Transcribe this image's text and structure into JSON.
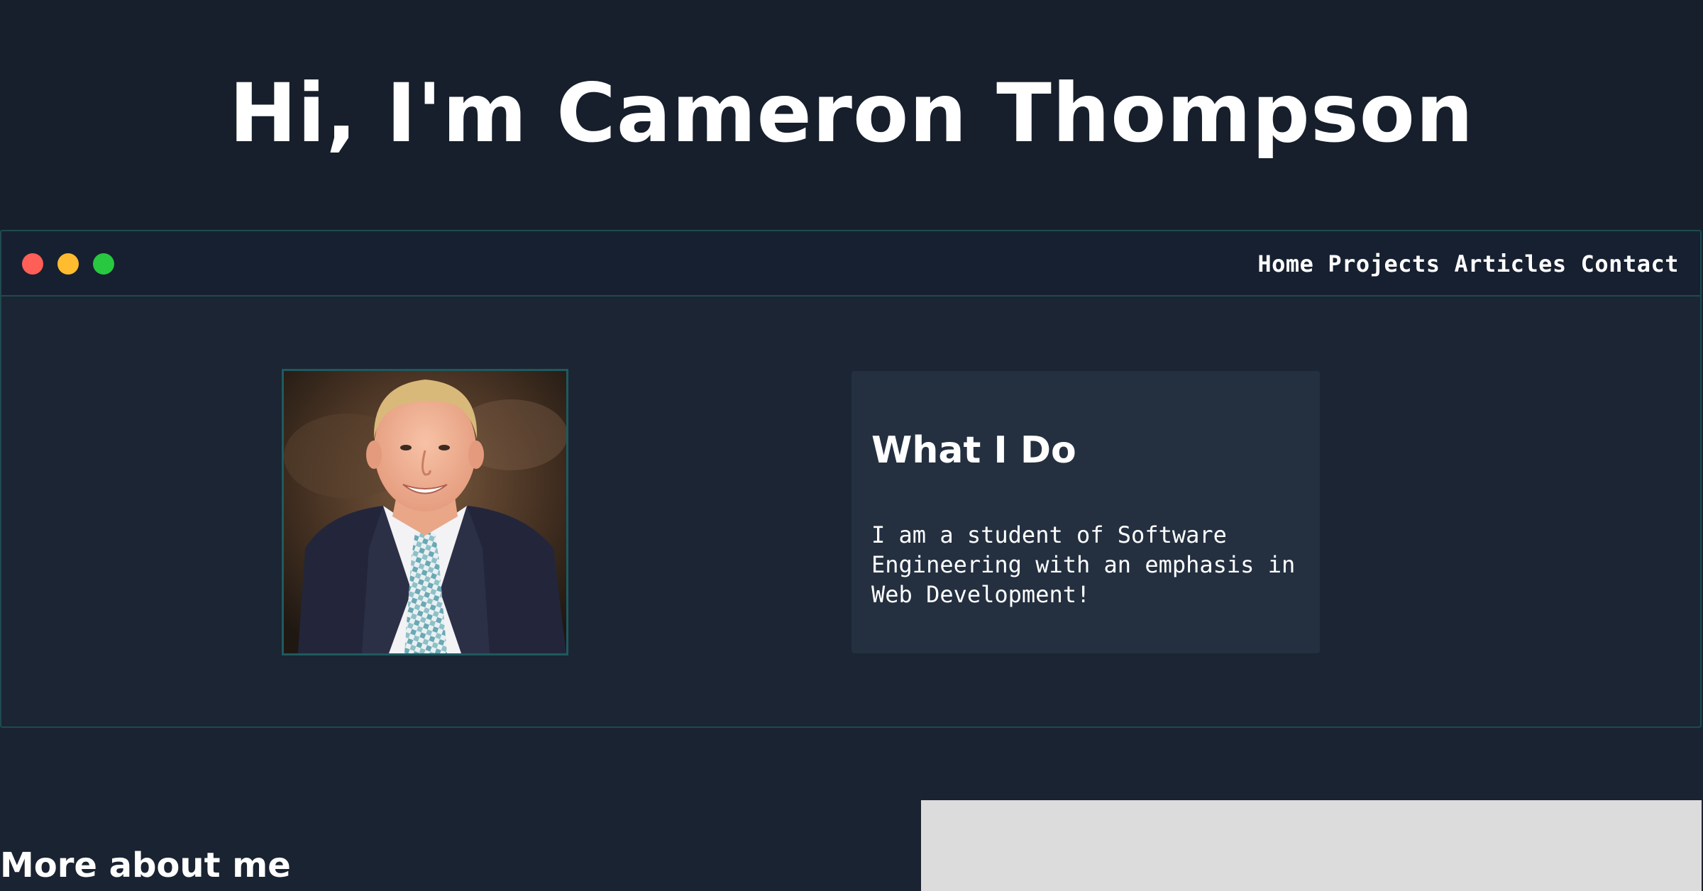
{
  "hero": {
    "title": "Hi, I'm Cameron Thompson"
  },
  "window": {
    "controls": [
      "close-dot",
      "minimize-dot",
      "maximize-dot"
    ],
    "nav": {
      "home": "Home",
      "projects": "Projects",
      "articles": "Articles",
      "contact": "Contact"
    }
  },
  "about_card": {
    "title": "What I Do",
    "body": "I am a student of Software Engineering with an emphasis in Web Development!"
  },
  "more": {
    "title": "More about me"
  },
  "colors": {
    "background": "#1a2331",
    "card": "#243040",
    "border_accent": "#1e4a50",
    "dot_red": "#ff5f57",
    "dot_yellow": "#febc2e",
    "dot_green": "#28c840"
  }
}
